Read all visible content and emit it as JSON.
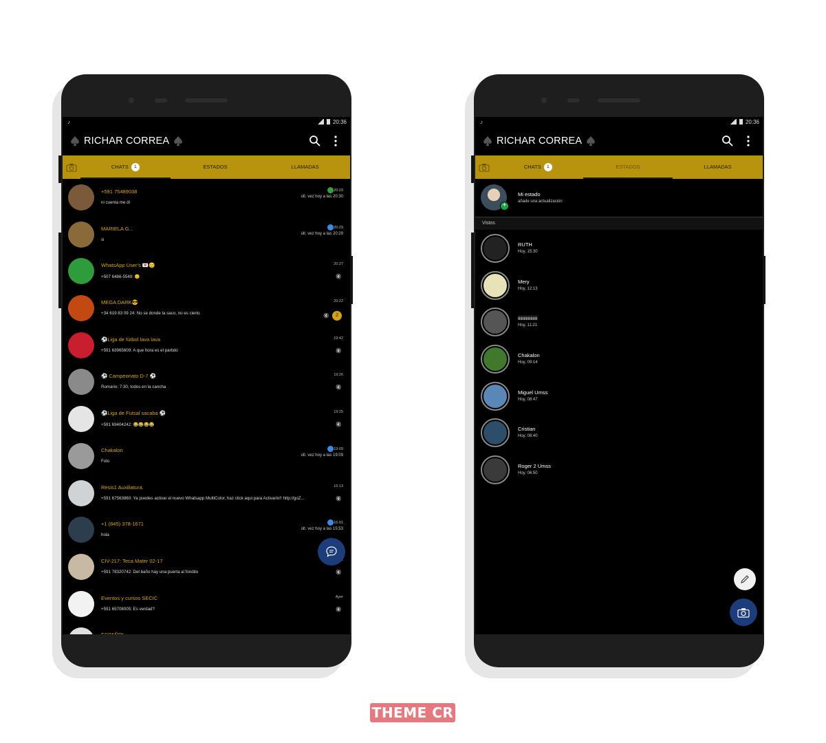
{
  "brand": "THEME CR",
  "colors": {
    "accent_bar": "#b8940e",
    "name_gold": "#d9a514",
    "fab_blue": "#1d3d7a",
    "screen_bg": "#000000"
  },
  "left_phone": {
    "status_time": "20:36",
    "app_title": "RICHAR CORREA",
    "tabs": [
      {
        "label": "CHATS",
        "count": "1"
      },
      {
        "label": "ESTADOS"
      },
      {
        "label": "LLAMADAS"
      }
    ],
    "chats": [
      {
        "name": "+591 75489038",
        "msg": "ni cuenta me di",
        "time": "20:29",
        "last_seen": "últ. vez hoy a las 20:30",
        "avatar_color": "#7a5a3a"
      },
      {
        "name": "MARIELA G...",
        "msg": "si",
        "time": "20:29",
        "last_seen": "últ. vez hoy a las 20:29",
        "avatar_color": "#8b6a3a"
      },
      {
        "name": "WhatsApp User's 💌😊",
        "msg": "+507 6486-5549: 😊",
        "time": "20:27",
        "avatar_color": "#2e9c3c"
      },
      {
        "name": "MEGA DARK😎",
        "msg": "+34 619 83 09 24: No se donde la saco, no es cierto",
        "time": "20:22",
        "unread": "2",
        "avatar_color": "#c24a12"
      },
      {
        "name": "⚽Liga de fútbol lava lava",
        "msg": "+591 63965609: A que hora es el partido",
        "time": "19:42",
        "avatar_color": "#c81e2e"
      },
      {
        "name": "⚽ Campeonato D-7 ⚽",
        "msg": "Romario: 7:30, todos en la cancha",
        "time": "19:26",
        "avatar_color": "#8a8a8a"
      },
      {
        "name": "⚽Liga de Futsal sacaba ⚽",
        "msg": "+591 69404242: 😂😂😂😂",
        "time": "19:25",
        "avatar_color": "#e5e5e5"
      },
      {
        "name": "Chakalon",
        "msg": "Foto",
        "time": "19:09",
        "last_seen": "últ. vez hoy a las 19:09",
        "avatar_color": "#9a9a9a"
      },
      {
        "name": "Resis1 Auxiliatura.",
        "msg": "+591 67563860: Ya puedes activar el nuevo Whatsapp MultiColor, haz click aqui para Activarlo!! http://goZ...",
        "time": "16:13",
        "avatar_color": "#cfd3d6"
      },
      {
        "name": "+1 (845) 378-1671",
        "msg": "hola",
        "time": "16:01",
        "last_seen": "últ. vez hoy a las 15:53",
        "avatar_color": "#2c3e4e"
      },
      {
        "name": "CIV-217: Teca Mater 02-17",
        "msg": "+591 78320742: Del baño hay una puerta al fondito",
        "time": "07:32",
        "avatar_color": "#c8b9a2"
      },
      {
        "name": "Eventos y cursos SECIC",
        "msg": "+591 65708005: Es verdad?",
        "time": "Ayer",
        "avatar_color": "#f2f2f2"
      },
      {
        "name": "ESPAÑOL",
        "msg": "",
        "time": "",
        "avatar_color": "#e0e0e0"
      }
    ]
  },
  "right_phone": {
    "status_time": "20:36",
    "app_title": "RICHAR CORREA",
    "tabs": [
      {
        "label": "CHATS",
        "count": "1"
      },
      {
        "label": "ESTADOS"
      },
      {
        "label": "LLAMADAS"
      }
    ],
    "my_status": {
      "name": "Mi estado",
      "sub": "añade una actualización"
    },
    "section": "Vistos",
    "statuses": [
      {
        "name": "RUTH",
        "time": "Hoy, 15:30",
        "color": "#222"
      },
      {
        "name": "Mery",
        "time": "Hoy, 12:13",
        "color": "#e8e2b8"
      },
      {
        "name": "iiiiiiiiiiiiiiiii",
        "time": "Hoy, 11:21",
        "color": "#555"
      },
      {
        "name": "Chakalon",
        "time": "Hoy, 09:14",
        "color": "#3f7a2c"
      },
      {
        "name": "Miguel Umss",
        "time": "Hoy, 08:47",
        "color": "#5a87b8"
      },
      {
        "name": "Cristian",
        "time": "Hoy, 08:40",
        "color": "#2d4d6a"
      },
      {
        "name": "Roger 2 Umss",
        "time": "Hoy, 06:50",
        "color": "#3a3a3a"
      }
    ]
  }
}
